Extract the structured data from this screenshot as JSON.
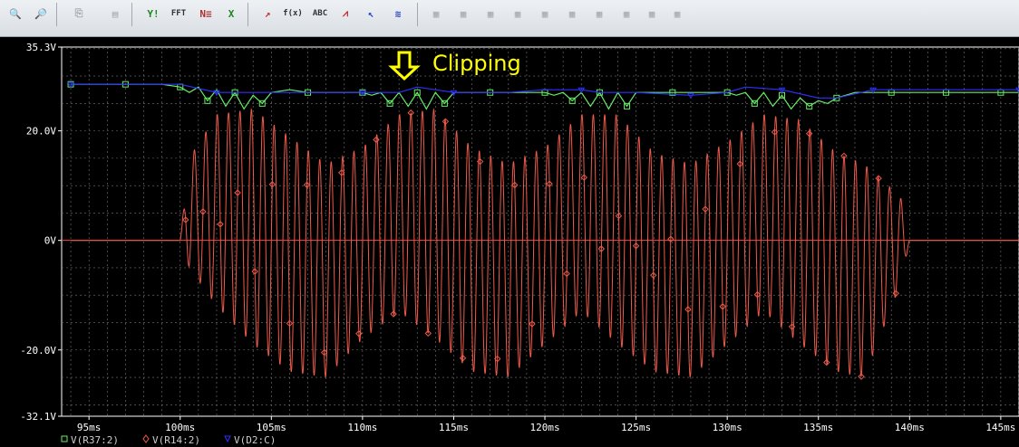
{
  "toolbar": {
    "items": [
      {
        "name": "zoom-in-icon",
        "glyph": "🔍",
        "enabled": true
      },
      {
        "name": "zoom-area-icon",
        "glyph": "🔎",
        "enabled": true
      },
      {
        "name": "copy-plot-icon",
        "glyph": "⎘",
        "enabled": false
      },
      {
        "name": "document-icon",
        "glyph": "▤",
        "enabled": false
      },
      {
        "name": "y-axis-icon",
        "glyph": "Y!",
        "enabled": true,
        "color": "#1a8a1a"
      },
      {
        "name": "fft-icon",
        "glyph": "FFT",
        "enabled": true
      },
      {
        "name": "performance-analysis-icon",
        "glyph": "N≡",
        "enabled": true,
        "color": "#b03030"
      },
      {
        "name": "x-axis-settings-icon",
        "glyph": "X",
        "enabled": true,
        "color": "#1a8a1a"
      },
      {
        "name": "add-trace-icon",
        "glyph": "↗",
        "enabled": true,
        "color": "#c03030"
      },
      {
        "name": "eval-goal-function-icon",
        "glyph": "f(x)",
        "enabled": true
      },
      {
        "name": "text-label-icon",
        "glyph": "ABC",
        "enabled": true
      },
      {
        "name": "marker-plot-icon",
        "glyph": "⩘",
        "enabled": true,
        "color": "#c03030"
      },
      {
        "name": "cursor-pointer-icon",
        "glyph": "↖",
        "enabled": true,
        "color": "#2040c0"
      },
      {
        "name": "toggle-cursor-icon",
        "glyph": "≋",
        "enabled": true,
        "color": "#2040c0"
      },
      {
        "name": "cursor-peak-icon",
        "glyph": "▦",
        "enabled": false
      },
      {
        "name": "cursor-trough-icon",
        "glyph": "▦",
        "enabled": false
      },
      {
        "name": "cursor-slope-icon",
        "glyph": "▦",
        "enabled": false
      },
      {
        "name": "cursor-min-icon",
        "glyph": "▦",
        "enabled": false
      },
      {
        "name": "cursor-max-icon",
        "glyph": "▦",
        "enabled": false
      },
      {
        "name": "cursor-point-icon",
        "glyph": "▦",
        "enabled": false
      },
      {
        "name": "cursor-search-icon",
        "glyph": "▦",
        "enabled": false
      },
      {
        "name": "next-transition-icon",
        "glyph": "▦",
        "enabled": false
      },
      {
        "name": "previous-transition-icon",
        "glyph": "▦",
        "enabled": false
      },
      {
        "name": "mark-label-icon",
        "glyph": "▦",
        "enabled": false
      }
    ]
  },
  "annotation": {
    "text": "Clipping",
    "color": "#ffff00"
  },
  "chart_data": {
    "type": "line",
    "xlabel": "",
    "ylabel": "",
    "xlim": [
      93.5,
      146
    ],
    "ylim": [
      -32.1,
      35.3
    ],
    "y_ticks": [
      {
        "value": 35.3,
        "label": "35.3V"
      },
      {
        "value": 20,
        "label": "20.0V"
      },
      {
        "value": 0,
        "label": "0V"
      },
      {
        "value": -20,
        "label": "-20.0V"
      },
      {
        "value": -32.1,
        "label": "-32.1V"
      }
    ],
    "x_ticks": [
      {
        "value": 95,
        "label": "95ms"
      },
      {
        "value": 100,
        "label": "100ms"
      },
      {
        "value": 105,
        "label": "105ms"
      },
      {
        "value": 110,
        "label": "110ms"
      },
      {
        "value": 115,
        "label": "115ms"
      },
      {
        "value": 120,
        "label": "120ms"
      },
      {
        "value": 125,
        "label": "125ms"
      },
      {
        "value": 130,
        "label": "130ms"
      },
      {
        "value": 135,
        "label": "135ms"
      },
      {
        "value": 140,
        "label": "140ms"
      },
      {
        "value": 145,
        "label": "145ms"
      }
    ],
    "grid": true,
    "zero_line_color": "#ff4040",
    "series": [
      {
        "name": "V(R37:2)",
        "color": "#66ee66",
        "marker": "square",
        "x": [
          94,
          95,
          96,
          97,
          98,
          99,
          100,
          100.5,
          101,
          101.5,
          102,
          102.5,
          103,
          103.5,
          104,
          104.5,
          105,
          106,
          107,
          108,
          109,
          110,
          110.5,
          111,
          111.5,
          112,
          112.5,
          113,
          113.5,
          114,
          114.5,
          115,
          116,
          117,
          118,
          119,
          120,
          120.5,
          121,
          121.5,
          122,
          122.5,
          123,
          123.5,
          124,
          124.5,
          125,
          126,
          127,
          128,
          129,
          130,
          130.5,
          131,
          131.5,
          132,
          132.5,
          133,
          133.5,
          134,
          134.5,
          135,
          135.5,
          136,
          137,
          138,
          139,
          140,
          141,
          142,
          143,
          144,
          145,
          146
        ],
        "y": [
          28.5,
          28.5,
          28.5,
          28.5,
          28.5,
          28.5,
          28,
          27,
          28,
          25.5,
          27.5,
          24.5,
          27,
          24,
          26.5,
          25,
          27,
          27.5,
          27,
          27,
          27,
          27,
          26.5,
          27,
          25,
          27,
          24.5,
          27,
          24,
          27,
          25,
          27,
          27,
          27,
          27,
          27,
          27,
          26.5,
          27,
          25.5,
          27,
          24.5,
          27,
          24,
          27,
          24.5,
          27,
          27,
          27,
          27,
          27,
          27,
          26.5,
          27,
          25,
          27,
          24.5,
          26.5,
          24,
          26,
          24.5,
          25.5,
          25,
          26,
          27,
          27,
          27,
          27,
          27,
          27,
          27,
          27,
          27,
          27
        ]
      },
      {
        "name": "V(R14:2)",
        "color": "#ee5a4a",
        "marker": "diamond",
        "envelope": [
          {
            "t": 94,
            "hi": 0,
            "lo": 0
          },
          {
            "t": 100,
            "hi": 0,
            "lo": 0
          },
          {
            "t": 100.5,
            "hi": 15,
            "lo": -5
          },
          {
            "t": 102,
            "hi": 23,
            "lo": -12
          },
          {
            "t": 104,
            "hi": 24,
            "lo": -19
          },
          {
            "t": 106,
            "hi": 19,
            "lo": -24
          },
          {
            "t": 108,
            "hi": 14,
            "lo": -25
          },
          {
            "t": 110,
            "hi": 17,
            "lo": -18
          },
          {
            "t": 112,
            "hi": 23,
            "lo": -13
          },
          {
            "t": 114,
            "hi": 24,
            "lo": -18
          },
          {
            "t": 116,
            "hi": 17,
            "lo": -24
          },
          {
            "t": 118,
            "hi": 14,
            "lo": -25
          },
          {
            "t": 120,
            "hi": 17,
            "lo": -19
          },
          {
            "t": 122,
            "hi": 23,
            "lo": -13
          },
          {
            "t": 124,
            "hi": 23,
            "lo": -19
          },
          {
            "t": 126,
            "hi": 16,
            "lo": -24
          },
          {
            "t": 128,
            "hi": 14,
            "lo": -25
          },
          {
            "t": 130,
            "hi": 18,
            "lo": -19
          },
          {
            "t": 132,
            "hi": 23,
            "lo": -13
          },
          {
            "t": 134,
            "hi": 22,
            "lo": -19
          },
          {
            "t": 136,
            "hi": 16,
            "lo": -24
          },
          {
            "t": 137.5,
            "hi": 14,
            "lo": -25
          },
          {
            "t": 139.5,
            "hi": 8,
            "lo": -8
          },
          {
            "t": 140,
            "hi": 0,
            "lo": 0
          },
          {
            "t": 146,
            "hi": 0,
            "lo": 0
          }
        ],
        "period_ms": 0.625
      },
      {
        "name": "V(D2:C)",
        "color": "#3030ff",
        "marker": "triangle",
        "x": [
          94,
          97,
          100,
          102,
          105,
          108,
          110,
          112,
          113,
          115,
          118,
          120,
          122,
          123,
          125,
          128,
          130,
          131,
          133,
          135,
          136,
          138,
          140,
          143,
          146
        ],
        "y": [
          28.5,
          28.5,
          28.5,
          27,
          27,
          27,
          27,
          27,
          28,
          27,
          27,
          27.5,
          27.5,
          27,
          27,
          26.5,
          27,
          28,
          27.5,
          26,
          26,
          27.5,
          27.5,
          27.5,
          27.5
        ]
      }
    ]
  }
}
